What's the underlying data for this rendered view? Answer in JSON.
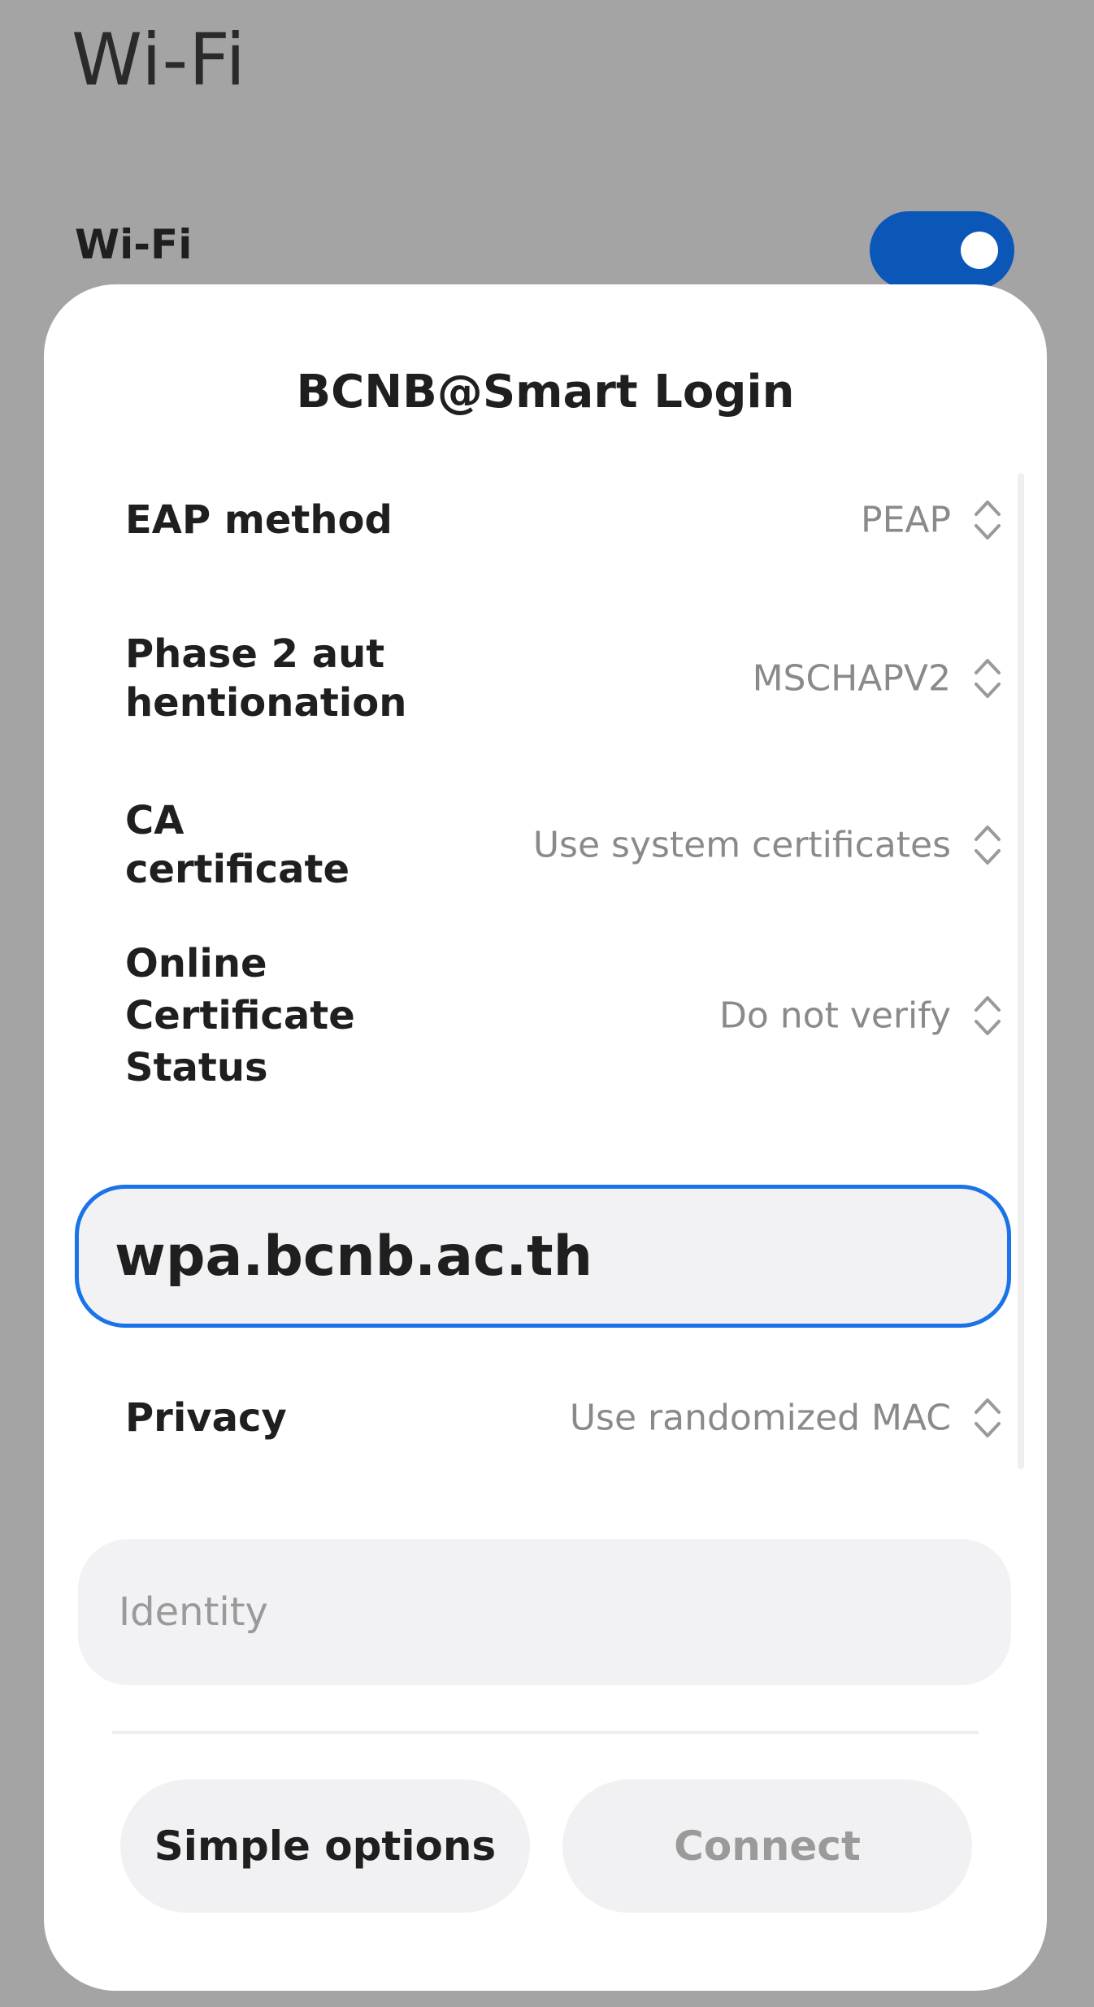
{
  "background": {
    "page_title": "Wi-Fi",
    "wifi_label": "Wi-Fi"
  },
  "dialog": {
    "title": "BCNB@Smart Login",
    "rows": [
      {
        "label": "EAP method",
        "value": "PEAP",
        "icon": "chevron-updown-icon"
      },
      {
        "label": "Phase 2 aut\nhentionation",
        "value": "MSCHAPV2",
        "icon": "chevron-updown-icon"
      },
      {
        "label": "CA\ncertificate",
        "value": "Use system certificates",
        "icon": "chevron-updown-icon"
      },
      {
        "label": "Online\nCertificate\nStatus",
        "value": "Do not verify",
        "icon": "chevron-updown-icon"
      }
    ],
    "domain_input_value": "wpa.bcnb.ac.th",
    "privacy": {
      "label": "Privacy",
      "value": "Use randomized MAC",
      "icon": "chevron-updown-icon"
    },
    "identity_placeholder": "Identity",
    "buttons": {
      "simple_options": "Simple options",
      "connect": "Connect"
    }
  },
  "colors": {
    "accent": "#1a73e8",
    "toggle_on": "#0b57b8",
    "scrim": "#a4a4a4"
  }
}
